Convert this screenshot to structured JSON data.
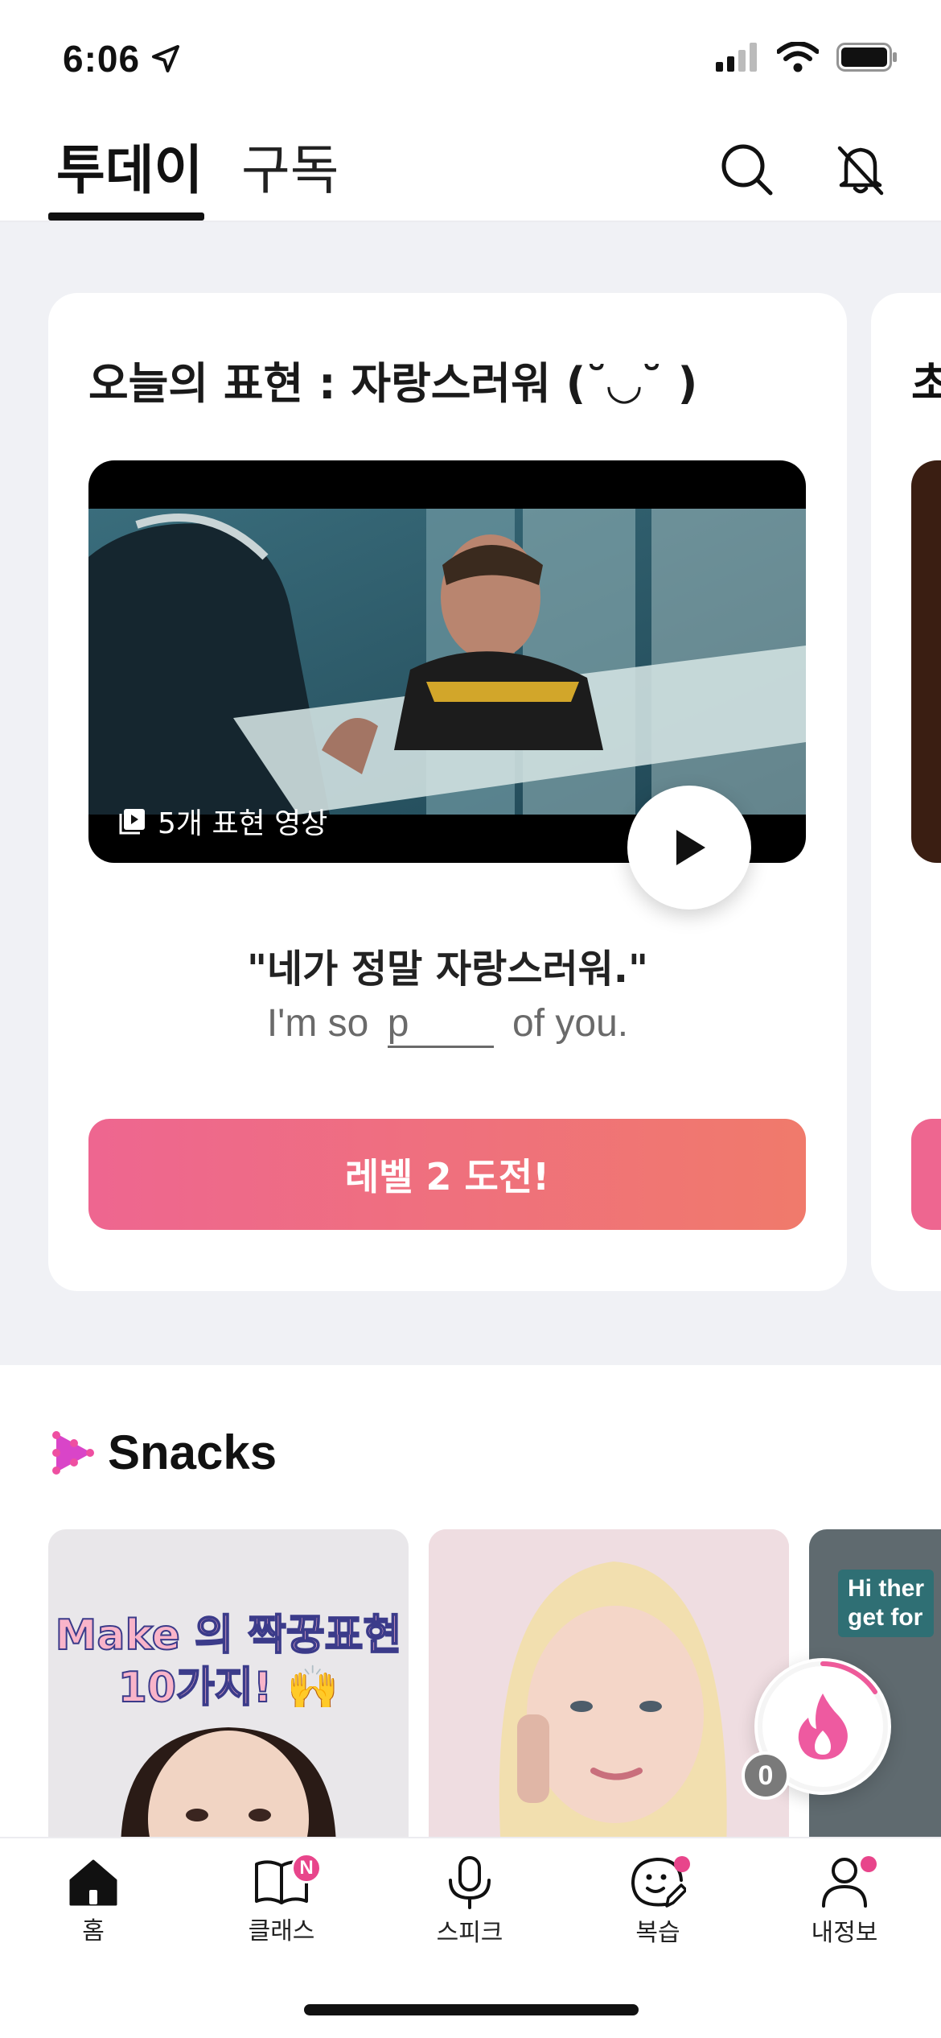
{
  "status_bar": {
    "time": "6:06"
  },
  "top_nav": {
    "tabs": [
      {
        "label": "투데이",
        "active": true
      },
      {
        "label": "구독",
        "active": false
      }
    ]
  },
  "today_card": {
    "title": "오늘의 표현 : 자랑스러워 (˘◡˘ )",
    "video_badge": "5개 표현 영상",
    "phrase_ko": "\"네가 정말 자랑스러워.\"",
    "phrase_en_before": "I'm so",
    "phrase_en_blank": "p",
    "phrase_en_after": "of you.",
    "challenge_button": "레벨 2 도전!"
  },
  "peek_card": {
    "title_fragment": "초"
  },
  "snacks": {
    "title": "Snacks",
    "items": [
      {
        "overlay_text_line1": "Make 의 짝꿍표현",
        "overlay_text_line2": "10가지! 🙌"
      },
      {
        "overlay_text_line1": ""
      },
      {
        "tag_line1": "Hi ther",
        "tag_line2": "get for"
      }
    ]
  },
  "streak": {
    "count": "0"
  },
  "tabbar": {
    "items": [
      {
        "label": "홈",
        "active": true
      },
      {
        "label": "클래스",
        "badge": "N"
      },
      {
        "label": "스피크"
      },
      {
        "label": "복습",
        "dot": true
      },
      {
        "label": "내정보",
        "dot": true
      }
    ]
  },
  "colors": {
    "accent_pink": "#e8458b",
    "button_gradient_start": "#ee6690",
    "button_gradient_end": "#f07a6b",
    "background_gray": "#f0f1f5"
  }
}
